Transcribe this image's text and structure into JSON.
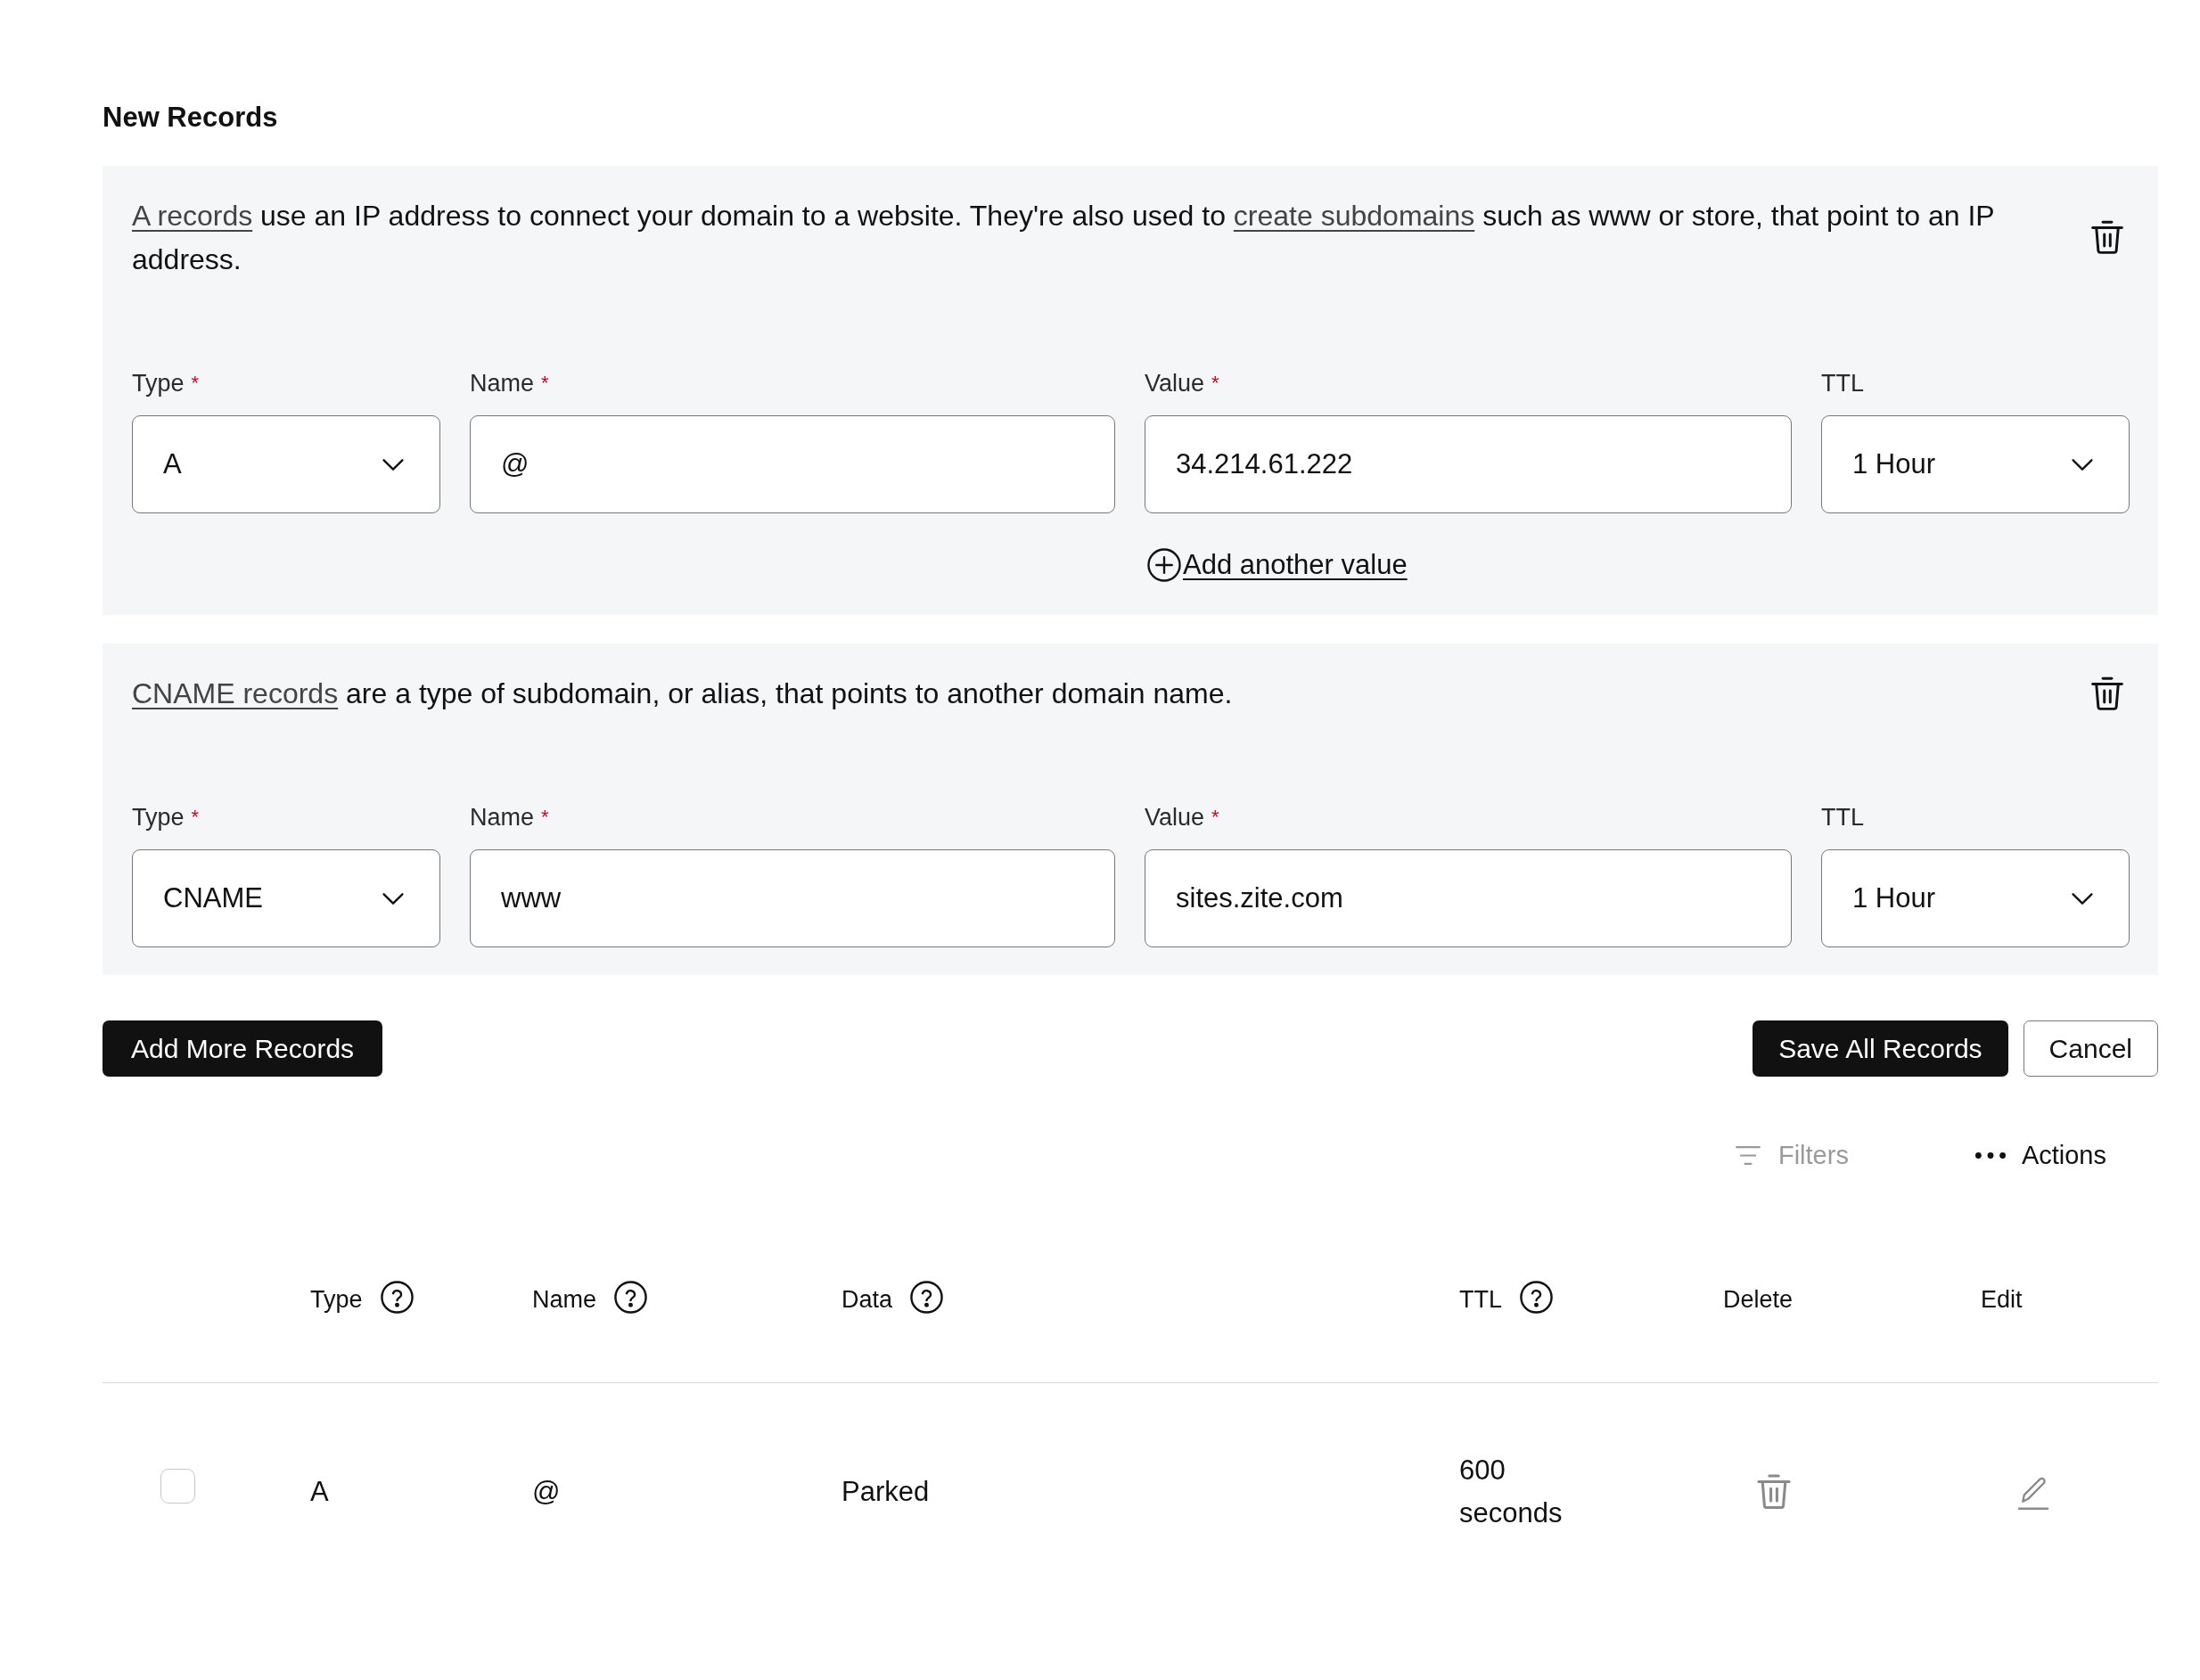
{
  "heading": "New Records",
  "record_forms": [
    {
      "description": [
        {
          "kind": "link",
          "text": "A records"
        },
        {
          "kind": "text",
          "text": "use an IP address to connect your domain to a website. They're also used to"
        },
        {
          "kind": "link",
          "text": "create subdomains"
        },
        {
          "kind": "text",
          "text": "such as www or store, that point to an IP address."
        }
      ],
      "fields": [
        {
          "kind": "select",
          "label": "Type",
          "required_mark": "*",
          "value": "A"
        },
        {
          "kind": "text",
          "label": "Name",
          "required_mark": "*",
          "value": "@"
        },
        {
          "kind": "text",
          "label": "Value",
          "required_mark": "*",
          "value": "34.214.61.222",
          "add_link": "Add another value"
        },
        {
          "kind": "select",
          "label": "TTL",
          "value": "1 Hour"
        }
      ]
    },
    {
      "description": [
        {
          "kind": "link",
          "text": "CNAME records"
        },
        {
          "kind": "text",
          "text": "are a type of subdomain, or alias, that points to another domain name."
        }
      ],
      "fields": [
        {
          "kind": "select",
          "label": "Type",
          "required_mark": "*",
          "value": "CNAME"
        },
        {
          "kind": "text",
          "label": "Name",
          "required_mark": "*",
          "value": "www"
        },
        {
          "kind": "text",
          "label": "Value",
          "required_mark": "*",
          "value": "sites.zite.com"
        },
        {
          "kind": "select",
          "label": "TTL",
          "value": "1 Hour"
        }
      ]
    }
  ],
  "buttons": {
    "add_more": "Add More Records",
    "save": "Save All Records",
    "cancel": "Cancel"
  },
  "table_toolbar": {
    "filters": {
      "label": "Filters",
      "disabled": true
    },
    "actions": {
      "label": "Actions"
    }
  },
  "table": {
    "columns": [
      {
        "label": "Type",
        "help": true
      },
      {
        "label": "Name",
        "help": true
      },
      {
        "label": "Data",
        "help": true
      },
      {
        "label": "TTL",
        "help": true
      },
      {
        "label": "Delete",
        "help": false
      },
      {
        "label": "Edit",
        "help": false
      }
    ],
    "rows": [
      {
        "checked": false,
        "type": "A",
        "name": "@",
        "data": "Parked",
        "ttl": "600 seconds"
      }
    ]
  }
}
